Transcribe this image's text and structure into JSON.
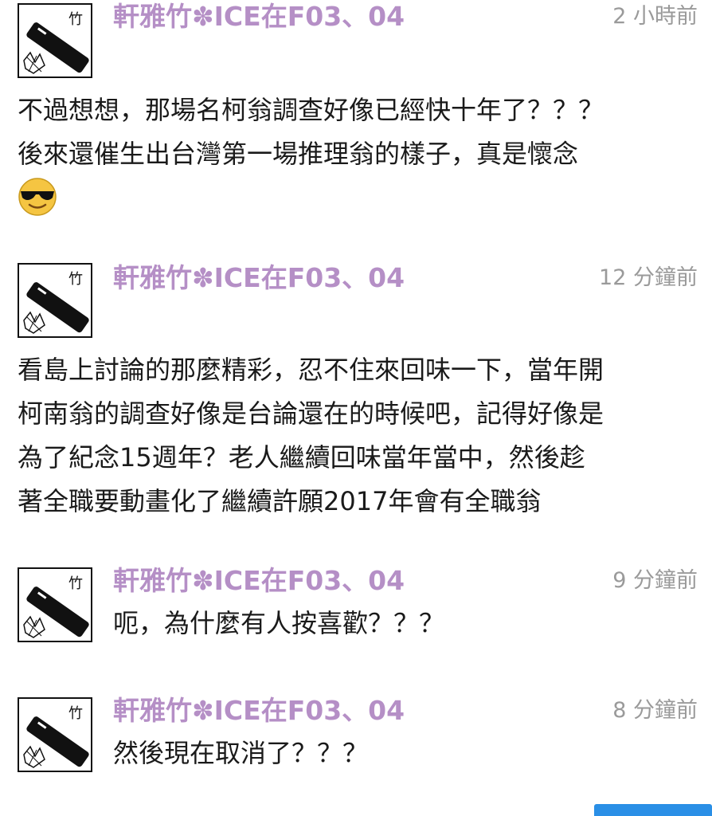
{
  "posts": [
    {
      "username": "軒雅竹✽ICE在F03、04",
      "time": "2 小時前",
      "lines": [
        "不過想想，那場名柯翁調查好像已經快十年了？？？",
        "後來還催生出台灣第一場推理翁的樣子，真是懷念"
      ],
      "emoji": "sunglasses-emoji"
    },
    {
      "username": "軒雅竹✽ICE在F03、04",
      "time": "12 分鐘前",
      "lines": [
        "看島上討論的那麼精彩，忍不住來回味一下，當年開",
        "柯南翁的調查好像是台論還在的時候吧，記得好像是",
        "為了紀念15週年？老人繼續回味當年當中，然後趁",
        "著全職要動畫化了繼續許願2017年會有全職翁"
      ]
    },
    {
      "username": "軒雅竹✽ICE在F03、04",
      "time": "9 分鐘前",
      "lines": [
        "呃，為什麼有人按喜歡？？？"
      ]
    },
    {
      "username": "軒雅竹✽ICE在F03、04",
      "time": "8 分鐘前",
      "lines": [
        "然後現在取消了？？？"
      ]
    }
  ],
  "avatar_char": "竹",
  "colors": {
    "username": "#b58fc6",
    "time": "#9a9a9a",
    "text": "#1a1a1a",
    "accent": "#2a8fe6"
  }
}
